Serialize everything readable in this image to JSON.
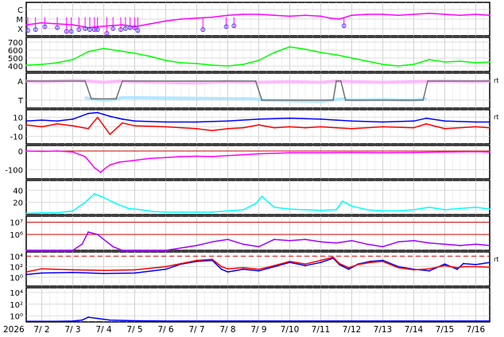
{
  "chart_data": {
    "type": "line",
    "date_labels": [
      "2026",
      "7/ 2",
      "7/ 3",
      "7/ 4",
      "7/ 5",
      "7/ 6",
      "7/ 7",
      "7/ 8",
      "7/ 9",
      "7/10",
      "7/11",
      "7/12",
      "7/13",
      "7/14",
      "7/15",
      "7/16"
    ],
    "x_start_day": 1.5,
    "x_end_day": 16.45,
    "panels": [
      {
        "id": "flare-class",
        "tick_labels": [
          "X",
          "M",
          "C"
        ],
        "series": [
          {
            "color": "#ff00ff",
            "x": [
              1.5,
              2.0,
              2.5,
              3.0,
              3.5,
              3.8,
              4.2,
              4.6,
              5.0,
              5.5,
              6.0,
              6.5,
              7.0,
              7.5,
              8.0,
              8.5,
              9.0,
              9.5,
              10.0,
              10.5,
              11.0,
              11.3,
              11.6,
              12.0,
              12.5,
              13.0,
              13.5,
              14.0,
              14.5,
              15.0,
              15.5,
              16.0,
              16.45
            ],
            "y": [
              1.6,
              1.4,
              1.5,
              1.6,
              1.9,
              1.8,
              1.7,
              1.6,
              1.8,
              1.5,
              1.2,
              1.0,
              0.9,
              0.8,
              0.6,
              0.5,
              0.5,
              0.6,
              0.7,
              0.6,
              0.7,
              0.9,
              1.0,
              0.6,
              0.5,
              0.5,
              0.6,
              0.5,
              0.4,
              0.5,
              0.6,
              0.5,
              0.6
            ]
          }
        ],
        "markers": [
          {
            "color": "#4040ff",
            "x": [
              1.55,
              1.8,
              2.1,
              2.5,
              2.8,
              2.95,
              3.2,
              3.4,
              3.55,
              3.7,
              3.8,
              4.1,
              4.3,
              4.55,
              4.7,
              4.85,
              5.0,
              5.1,
              7.2,
              7.95,
              8.2,
              11.75
            ],
            "y": [
              2.2,
              2.1,
              1.8,
              1.9,
              2.3,
              2.3,
              2.1,
              2.0,
              2.1,
              2.1,
              2.1,
              2.5,
              2.0,
              2.1,
              2.0,
              1.9,
              1.9,
              2.2,
              2.1,
              1.8,
              1.7,
              1.7
            ]
          }
        ]
      },
      {
        "id": "solar-wind-speed",
        "tick_labels": [
          "400",
          "500",
          "600",
          "700"
        ],
        "tick_values": [
          400,
          500,
          600,
          700
        ],
        "ylim": [
          330,
          760
        ],
        "series": [
          {
            "color": "#00ff00",
            "x": [
              1.5,
              2.0,
              2.5,
              3.0,
              3.5,
              4.0,
              4.5,
              5.0,
              5.5,
              6.0,
              6.5,
              7.0,
              7.5,
              8.0,
              8.5,
              9.0,
              9.5,
              10.0,
              10.5,
              11.0,
              11.5,
              12.0,
              12.5,
              13.0,
              13.5,
              14.0,
              14.5,
              15.0,
              15.5,
              16.0,
              16.45
            ],
            "y": [
              410,
              420,
              440,
              480,
              580,
              620,
              590,
              560,
              520,
              470,
              440,
              430,
              410,
              400,
              420,
              470,
              570,
              640,
              610,
              570,
              540,
              500,
              460,
              420,
              400,
              420,
              480,
              450,
              460,
              440,
              450
            ]
          }
        ]
      },
      {
        "id": "imf-sector",
        "tick_labels": [
          "T",
          "A"
        ],
        "right_label": "rt",
        "series": [
          {
            "color": "#ffb0ff",
            "x": [
              1.5,
              2.0,
              2.5,
              3.0,
              3.5,
              4.0,
              4.5,
              5.0,
              6.0,
              7.0,
              8.0,
              9.0,
              10.0,
              11.0,
              11.5,
              12.0,
              13.0,
              14.0,
              15.0,
              16.0,
              16.45
            ],
            "y": [
              0.3,
              0.35,
              0.3,
              0.25,
              0.3,
              0.4,
              0.3,
              0.35,
              0.4,
              0.45,
              0.35,
              0.4,
              0.35,
              0.4,
              0.3,
              0.35,
              0.4,
              0.35,
              0.3,
              0.35,
              0.3
            ]
          },
          {
            "color": "#a8e4ff",
            "x": [
              3.4,
              3.6,
              4.0,
              4.3,
              4.6,
              8.9,
              9.2,
              10.0,
              11.0,
              11.35,
              11.7,
              12.0,
              13.0,
              13.6,
              14.0,
              14.4
            ],
            "y": [
              1.6,
              1.7,
              1.8,
              1.75,
              1.6,
              1.7,
              1.8,
              1.85,
              1.9,
              1.8,
              1.7,
              1.8,
              1.75,
              1.8,
              1.8,
              1.7
            ]
          },
          {
            "color": "#707070",
            "x": [
              1.5,
              3.4,
              3.6,
              4.4,
              4.6,
              8.9,
              9.1,
              11.4,
              11.5,
              11.65,
              11.8,
              14.3,
              14.45,
              16.45
            ],
            "y": [
              0.3,
              0.3,
              1.7,
              1.7,
              0.3,
              0.3,
              1.8,
              1.8,
              0.3,
              0.3,
              1.8,
              1.8,
              0.3,
              0.3
            ]
          }
        ]
      },
      {
        "id": "imf-components",
        "tick_labels": [
          "-10",
          "0",
          "10"
        ],
        "tick_values": [
          -10,
          0,
          10
        ],
        "right_label": "rt",
        "ylim": [
          -18,
          18
        ],
        "series": [
          {
            "color": "#0000ff",
            "x": [
              1.5,
              2.0,
              2.5,
              3.0,
              3.5,
              3.8,
              4.2,
              4.6,
              5.0,
              6.0,
              7.0,
              8.0,
              9.0,
              10.0,
              11.0,
              11.5,
              12.0,
              13.0,
              14.0,
              14.4,
              15.0,
              16.0,
              16.45
            ],
            "y": [
              6,
              7,
              6,
              8,
              14,
              15,
              11,
              8,
              6,
              5,
              5,
              6,
              8,
              9,
              8,
              7,
              6,
              5,
              6,
              9,
              6,
              5,
              5
            ]
          },
          {
            "color": "#ff0000",
            "x": [
              1.5,
              2.0,
              2.5,
              3.0,
              3.5,
              3.8,
              4.2,
              4.6,
              5.0,
              6.0,
              7.0,
              7.5,
              8.0,
              8.5,
              9.0,
              9.5,
              10.0,
              10.5,
              11.0,
              11.5,
              12.0,
              13.0,
              14.0,
              14.4,
              15.0,
              16.0,
              16.45
            ],
            "y": [
              2,
              0,
              3,
              1,
              -2,
              10,
              -8,
              4,
              1,
              0,
              -2,
              -4,
              -2,
              -1,
              2,
              -1,
              0,
              -1,
              0,
              -1,
              -2,
              0,
              -1,
              3,
              -2,
              0,
              -1
            ]
          }
        ]
      },
      {
        "id": "dst-index",
        "tick_labels": [
          "-100",
          "0"
        ],
        "tick_values": [
          -100,
          0
        ],
        "ylim": [
          -150,
          30
        ],
        "reference_line": 0,
        "series": [
          {
            "color": "#ff00ff",
            "x": [
              1.5,
              2.0,
              2.5,
              3.0,
              3.4,
              3.7,
              3.9,
              4.0,
              4.2,
              4.5,
              5.0,
              5.5,
              6.0,
              6.5,
              7.0,
              7.5,
              8.0,
              8.5,
              9.0,
              10.0,
              11.0,
              12.0,
              13.0,
              14.0,
              15.0,
              16.0,
              16.45
            ],
            "y": [
              0,
              -2,
              0,
              -5,
              -30,
              -90,
              -115,
              -100,
              -75,
              -60,
              -50,
              -40,
              -35,
              -30,
              -28,
              -30,
              -25,
              -20,
              -15,
              -10,
              -10,
              -8,
              -10,
              -8,
              -5,
              -3,
              -5
            ]
          }
        ]
      },
      {
        "id": "proton-density",
        "tick_labels": [
          "20",
          "40"
        ],
        "tick_values": [
          20,
          40
        ],
        "ylim": [
          0,
          56
        ],
        "series": [
          {
            "color": "#00ffff",
            "x": [
              1.5,
              2.0,
              2.5,
              3.0,
              3.4,
              3.7,
              4.0,
              4.4,
              4.8,
              5.2,
              5.6,
              6.0,
              6.5,
              7.0,
              7.5,
              8.0,
              8.5,
              8.9,
              9.1,
              9.5,
              10.0,
              10.5,
              11.0,
              11.5,
              11.7,
              12.0,
              12.5,
              13.0,
              13.5,
              14.0,
              14.5,
              15.0,
              15.5,
              16.0,
              16.45
            ],
            "y": [
              2,
              3,
              3,
              6,
              20,
              34,
              28,
              18,
              10,
              8,
              5,
              4,
              4,
              4,
              4,
              6,
              8,
              18,
              30,
              12,
              9,
              8,
              7,
              8,
              22,
              14,
              8,
              6,
              6,
              8,
              12,
              8,
              10,
              12,
              9
            ]
          }
        ]
      },
      {
        "id": "electron-flux",
        "tick_labels": [
          "10⁶",
          "10⁷"
        ],
        "tick_values": [
          6,
          7
        ],
        "ylim": [
          4.7,
          7.5
        ],
        "reference_lines": [
          6,
          7
        ],
        "series": [
          {
            "color": "#a000ff",
            "x": [
              1.5,
              3.0,
              3.3,
              3.5,
              3.8,
              4.0,
              4.3,
              4.6,
              5.0,
              6.0,
              7.0,
              7.5,
              8.0,
              8.5,
              9.0,
              9.5,
              10.0,
              10.5,
              11.0,
              11.5,
              12.0,
              12.5,
              13.0,
              13.5,
              14.0,
              14.5,
              15.0,
              15.5,
              16.0,
              16.45
            ],
            "y": [
              4.7,
              4.7,
              5.2,
              6.2,
              6.0,
              5.6,
              5.0,
              4.7,
              4.7,
              4.7,
              5.1,
              5.4,
              5.6,
              5.2,
              5.0,
              5.6,
              5.5,
              5.6,
              5.4,
              5.3,
              5.5,
              5.2,
              5.0,
              5.4,
              5.5,
              5.3,
              5.2,
              5.1,
              5.2,
              5.1
            ]
          }
        ]
      },
      {
        "id": "proton-flux",
        "tick_labels": [
          "10⁰",
          "10²",
          "10⁴"
        ],
        "tick_values": [
          0,
          2,
          4
        ],
        "right_label": "rt",
        "ylim": [
          -1.7,
          4.8
        ],
        "reference_line": 4,
        "series": [
          {
            "color": "#0000ff",
            "x": [
              1.5,
              2.0,
              3.0,
              4.0,
              5.0,
              6.0,
              6.5,
              7.0,
              7.5,
              7.8,
              8.0,
              8.5,
              9.0,
              9.5,
              10.0,
              10.5,
              11.0,
              11.4,
              11.6,
              11.9,
              12.2,
              12.6,
              13.0,
              13.5,
              14.0,
              14.5,
              15.0,
              15.4,
              15.6,
              16.0,
              16.45
            ],
            "y": [
              0.5,
              0.8,
              0.9,
              0.7,
              0.8,
              1.5,
              2.5,
              3.0,
              3.2,
              1.5,
              1.0,
              1.5,
              1.2,
              2.0,
              2.8,
              2.2,
              2.8,
              3.6,
              2.4,
              1.5,
              2.5,
              3.0,
              3.2,
              2.0,
              1.5,
              1.2,
              2.5,
              1.5,
              2.6,
              2.4,
              2.8
            ]
          },
          {
            "color": "#ff0000",
            "x": [
              1.5,
              2.0,
              3.0,
              4.0,
              5.0,
              6.0,
              6.5,
              7.0,
              7.5,
              7.8,
              8.0,
              8.5,
              9.0,
              9.5,
              10.0,
              10.5,
              11.0,
              11.4,
              11.6,
              11.9,
              12.2,
              12.6,
              13.0,
              13.5,
              14.0,
              14.5,
              15.0,
              15.4,
              15.6,
              16.0,
              16.45
            ],
            "y": [
              1.0,
              1.6,
              1.4,
              1.3,
              1.4,
              2.0,
              2.6,
              3.2,
              3.4,
              2.0,
              1.6,
              1.8,
              1.5,
              2.2,
              3.0,
              2.5,
              3.2,
              3.8,
              2.6,
              1.8,
              2.4,
              2.8,
              3.0,
              1.8,
              1.4,
              1.6,
              2.2,
              1.8,
              2.0,
              2.0,
              1.9
            ]
          }
        ]
      },
      {
        "id": "high-energy-proton-flux",
        "tick_labels": [
          "10⁰",
          "10²",
          "10⁴"
        ],
        "tick_values": [
          0,
          2,
          4
        ],
        "ylim": [
          -1.0,
          4.8
        ],
        "series": [
          {
            "color": "#0000ff",
            "x": [
              1.5,
              2.5,
              3.0,
              3.3,
              3.5,
              3.8,
              4.2,
              5.0,
              6.0,
              8.0,
              10.0,
              12.0,
              14.0,
              16.0,
              16.45
            ],
            "y": [
              -0.9,
              -0.9,
              -0.85,
              -0.7,
              -0.2,
              -0.4,
              -0.7,
              -0.8,
              -0.85,
              -0.85,
              -0.85,
              -0.85,
              -0.85,
              -0.85,
              -0.85
            ]
          }
        ]
      }
    ]
  }
}
